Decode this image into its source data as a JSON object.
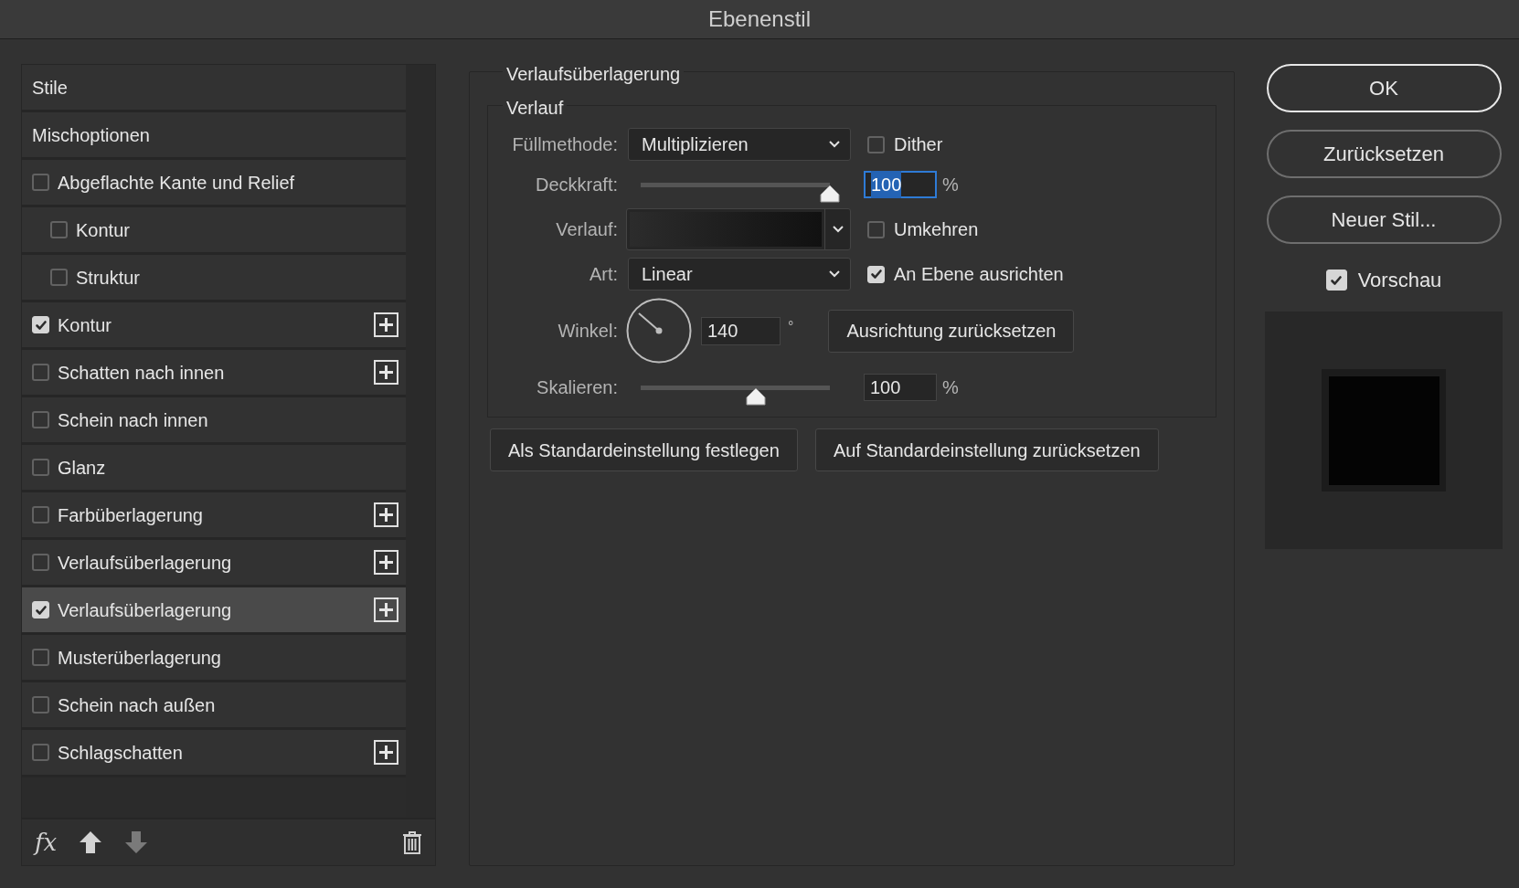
{
  "window": {
    "title": "Ebenenstil"
  },
  "styles_list": {
    "items": [
      {
        "kind": "header",
        "label": "Stile",
        "selected": false
      },
      {
        "kind": "header",
        "label": "Mischoptionen",
        "selected": false
      },
      {
        "kind": "effect",
        "label": "Abgeflachte Kante und Relief",
        "checked": false,
        "add": false,
        "selected": false,
        "children": [
          {
            "kind": "effect",
            "label": "Kontur",
            "checked": false,
            "add": false,
            "selected": false
          },
          {
            "kind": "effect",
            "label": "Struktur",
            "checked": false,
            "add": false,
            "selected": false
          }
        ]
      },
      {
        "kind": "effect",
        "label": "Kontur",
        "checked": true,
        "add": true,
        "selected": false
      },
      {
        "kind": "effect",
        "label": "Schatten nach innen",
        "checked": false,
        "add": true,
        "selected": false
      },
      {
        "kind": "effect",
        "label": "Schein nach innen",
        "checked": false,
        "add": false,
        "selected": false
      },
      {
        "kind": "effect",
        "label": "Glanz",
        "checked": false,
        "add": false,
        "selected": false
      },
      {
        "kind": "effect",
        "label": "Farbüberlagerung",
        "checked": false,
        "add": true,
        "selected": false
      },
      {
        "kind": "effect",
        "label": "Verlaufsüberlagerung",
        "checked": false,
        "add": true,
        "selected": false
      },
      {
        "kind": "effect",
        "label": "Verlaufsüberlagerung",
        "checked": true,
        "add": true,
        "selected": true
      },
      {
        "kind": "effect",
        "label": "Musterüberlagerung",
        "checked": false,
        "add": false,
        "selected": false
      },
      {
        "kind": "effect",
        "label": "Schein nach außen",
        "checked": false,
        "add": false,
        "selected": false
      },
      {
        "kind": "effect",
        "label": "Schlagschatten",
        "checked": false,
        "add": true,
        "selected": false
      }
    ],
    "footer": {
      "fx_label": "fx"
    }
  },
  "settings": {
    "group_title": "Verlaufsüberlagerung",
    "subgroup_title": "Verlauf",
    "fill_method": {
      "label": "Füllmethode:",
      "value": "Multiplizieren"
    },
    "dither": {
      "label": "Dither",
      "checked": false
    },
    "opacity": {
      "label": "Deckkraft:",
      "level": 1,
      "value": "100",
      "unit": "%",
      "text_highlighted": true
    },
    "gradient": {
      "label": "Verlauf:"
    },
    "reverse": {
      "label": "Umkehren",
      "checked": false
    },
    "style": {
      "label": "Art:",
      "value": "Linear"
    },
    "align_with_layer": {
      "label": "An Ebene ausrichten",
      "checked": true
    },
    "angle": {
      "label": "Winkel:",
      "value": "140",
      "unit": "°"
    },
    "reset_alignment_button": "Ausrichtung zurücksetzen",
    "scale": {
      "label": "Skalieren:",
      "level": 0.61,
      "value": "100",
      "unit": "%",
      "text_highlighted": false
    },
    "buttons": [
      "Als Standardeinstellung festlegen",
      "Auf Standardeinstellung zurücksetzen"
    ]
  },
  "actions": {
    "buttons": [
      {
        "label": "OK",
        "default": true
      },
      {
        "label": "Zurücksetzen",
        "default": false
      },
      {
        "label": "Neuer Stil...",
        "default": false
      }
    ],
    "preview": {
      "label": "Vorschau",
      "checked": true
    }
  }
}
